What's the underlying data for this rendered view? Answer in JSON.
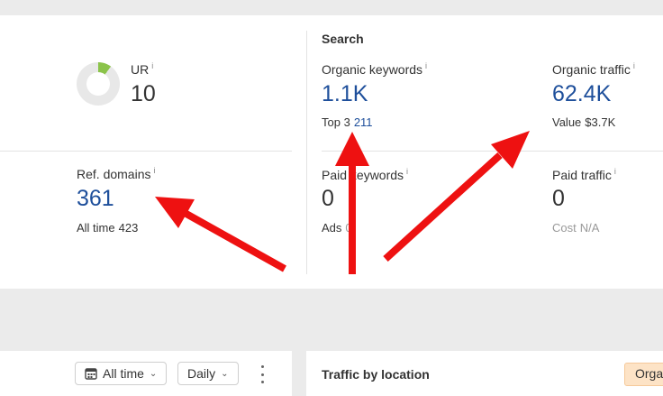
{
  "overview": {
    "ur": {
      "label": "UR",
      "info": "i",
      "value": "10",
      "fraction": 0.1
    },
    "ref_domains": {
      "label": "Ref. domains",
      "info": "i",
      "value": "361",
      "sub_label": "All time",
      "sub_value": "423"
    }
  },
  "search": {
    "title": "Search",
    "organic_keywords": {
      "label": "Organic keywords",
      "info": "i",
      "value": "1.1K",
      "sub_label": "Top 3",
      "sub_value": "211"
    },
    "organic_traffic": {
      "label": "Organic traffic",
      "info": "i",
      "value": "62.4K",
      "sub_label": "Value",
      "sub_value": "$3.7K"
    },
    "paid_keywords": {
      "label": "Paid keywords",
      "info": "i",
      "value": "0",
      "sub_label": "Ads",
      "sub_value": "0"
    },
    "paid_traffic": {
      "label": "Paid traffic",
      "info": "i",
      "value": "0",
      "sub_label": "Cost",
      "sub_value": "N/A"
    }
  },
  "toolbar": {
    "date_range": "All time",
    "interval": "Daily"
  },
  "traffic_panel": {
    "title": "Traffic by location",
    "tag": "Organic"
  },
  "colors": {
    "link": "#1e4f9b",
    "arrow": "#ee1111",
    "ur_fill": "#8bc34a",
    "tag_bg": "#fde3c6"
  },
  "icons": [
    "calendar-icon",
    "chevron-down-icon",
    "more-vertical-icon",
    "info-icon"
  ]
}
